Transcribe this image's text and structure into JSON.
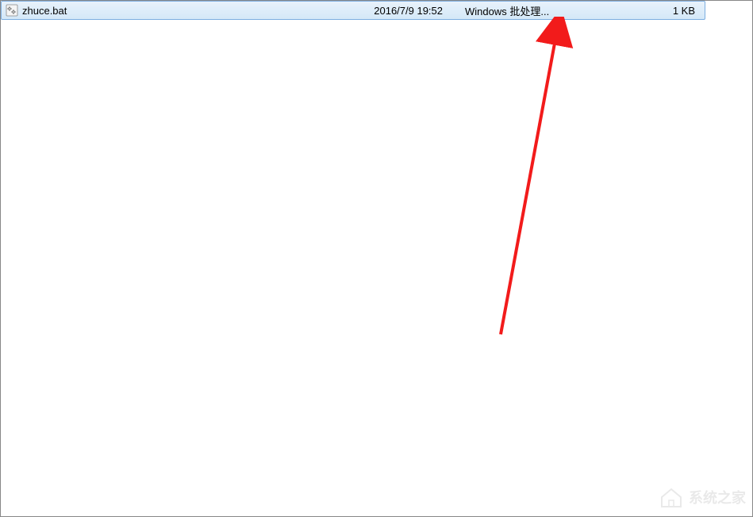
{
  "file": {
    "name": "zhuce.bat",
    "date": "2016/7/9 19:52",
    "type": "Windows 批处理...",
    "size": "1 KB"
  },
  "watermark": {
    "text": "系统之家"
  }
}
